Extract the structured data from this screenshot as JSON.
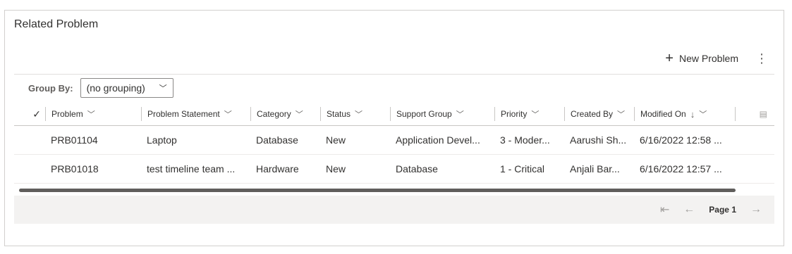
{
  "panel": {
    "title": "Related Problem"
  },
  "commandbar": {
    "new_label": "New Problem"
  },
  "groupby": {
    "label": "Group By:",
    "value": "(no grouping)"
  },
  "columns": [
    {
      "label": "Problem"
    },
    {
      "label": "Problem Statement"
    },
    {
      "label": "Category"
    },
    {
      "label": "Status"
    },
    {
      "label": "Support Group"
    },
    {
      "label": "Priority"
    },
    {
      "label": "Created By"
    },
    {
      "label": "Modified On"
    }
  ],
  "rows": [
    [
      "PRB01104",
      "Laptop",
      "Database",
      "New",
      "Application Devel...",
      "3 - Moder...",
      "Aarushi Sh...",
      "6/16/2022 12:58 ..."
    ],
    [
      "PRB01018",
      "test timeline team ...",
      "Hardware",
      "New",
      "Database",
      "1 - Critical",
      "Anjali Bar...",
      "6/16/2022 12:57 ..."
    ]
  ],
  "pager": {
    "page_label": "Page 1"
  }
}
